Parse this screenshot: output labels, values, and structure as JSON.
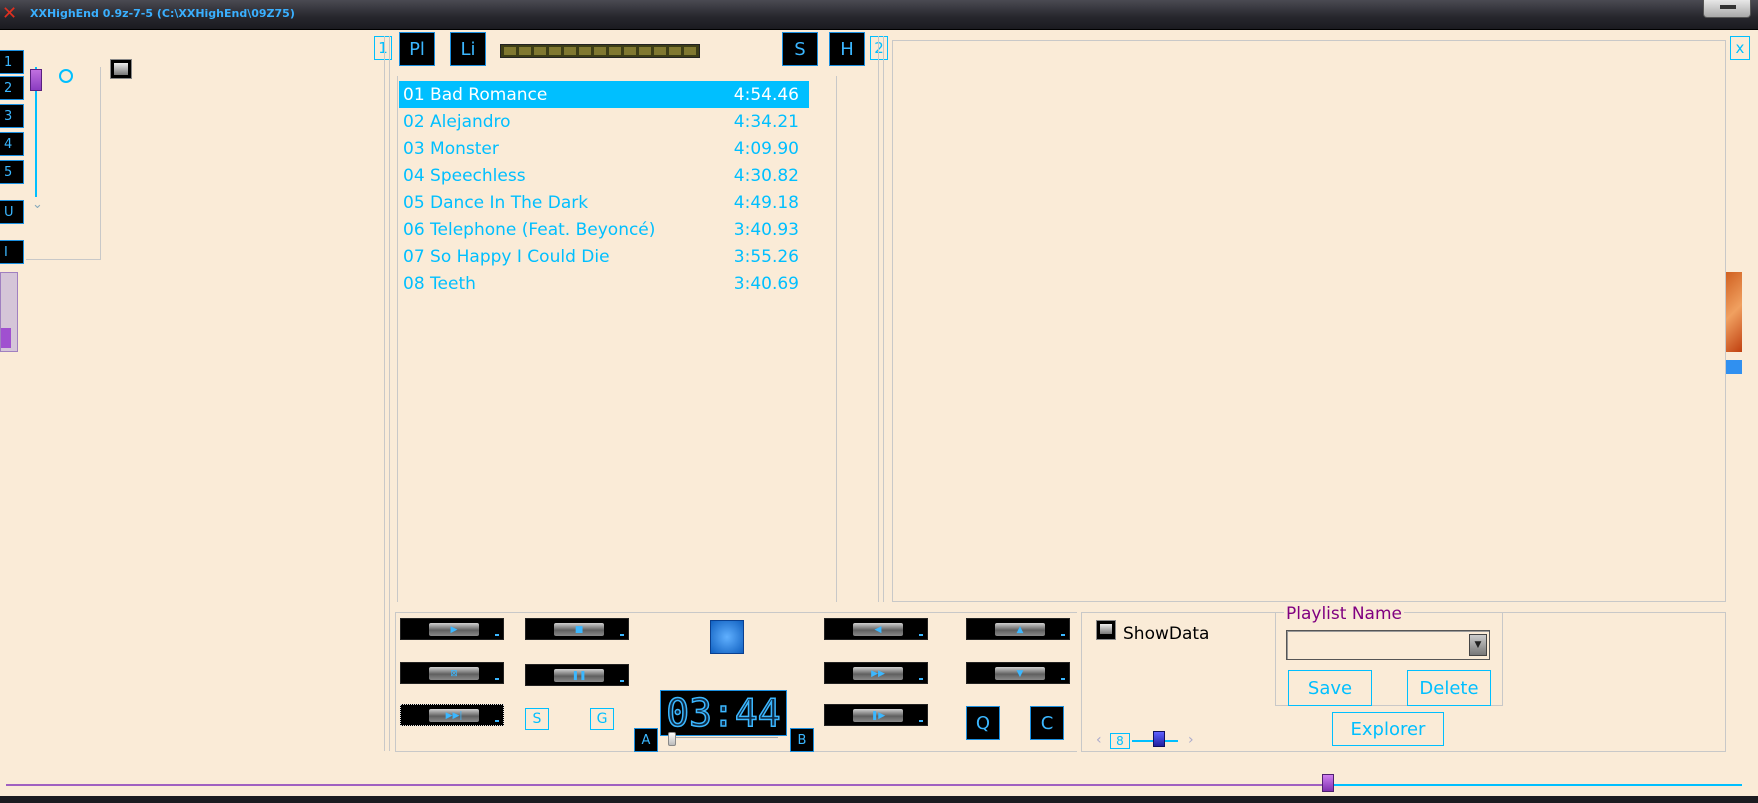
{
  "window": {
    "title": "XXHighEnd 0.9z-7-5 (C:\\XXHighEnd\\09Z75)"
  },
  "left_tabs": [
    "1",
    "2",
    "3",
    "4",
    "5",
    "U",
    "I"
  ],
  "top_buttons": {
    "pane1": "1",
    "playlist": "Pl",
    "library": "Li",
    "settings": "S",
    "help": "H",
    "pane2": "2",
    "close": "x"
  },
  "tracks": [
    {
      "title": "01 Bad Romance",
      "duration": "4:54.46",
      "selected": true
    },
    {
      "title": "02 Alejandro",
      "duration": "4:34.21"
    },
    {
      "title": "03 Monster",
      "duration": "4:09.90"
    },
    {
      "title": "04 Speechless",
      "duration": "4:30.82"
    },
    {
      "title": "05 Dance In The Dark",
      "duration": "4:49.18"
    },
    {
      "title": "06 Telephone (Feat. Beyoncé)",
      "duration": "3:40.93"
    },
    {
      "title": "07 So Happy I Could Die",
      "duration": "3:55.26"
    },
    {
      "title": "08 Teeth",
      "duration": "3:40.69"
    }
  ],
  "small_buttons": {
    "s": "S",
    "g": "G",
    "q": "Q",
    "c": "C",
    "a": "A",
    "b": "B"
  },
  "time_display": "03:44",
  "show_data_label": "ShowData",
  "counter": "8",
  "playlist_panel": {
    "name_label": "Playlist Name",
    "save": "Save",
    "delete": "Delete",
    "explorer": "Explorer"
  },
  "colors": {
    "background": "#faebd7",
    "accent": "#00bfff",
    "label": "#800080"
  }
}
